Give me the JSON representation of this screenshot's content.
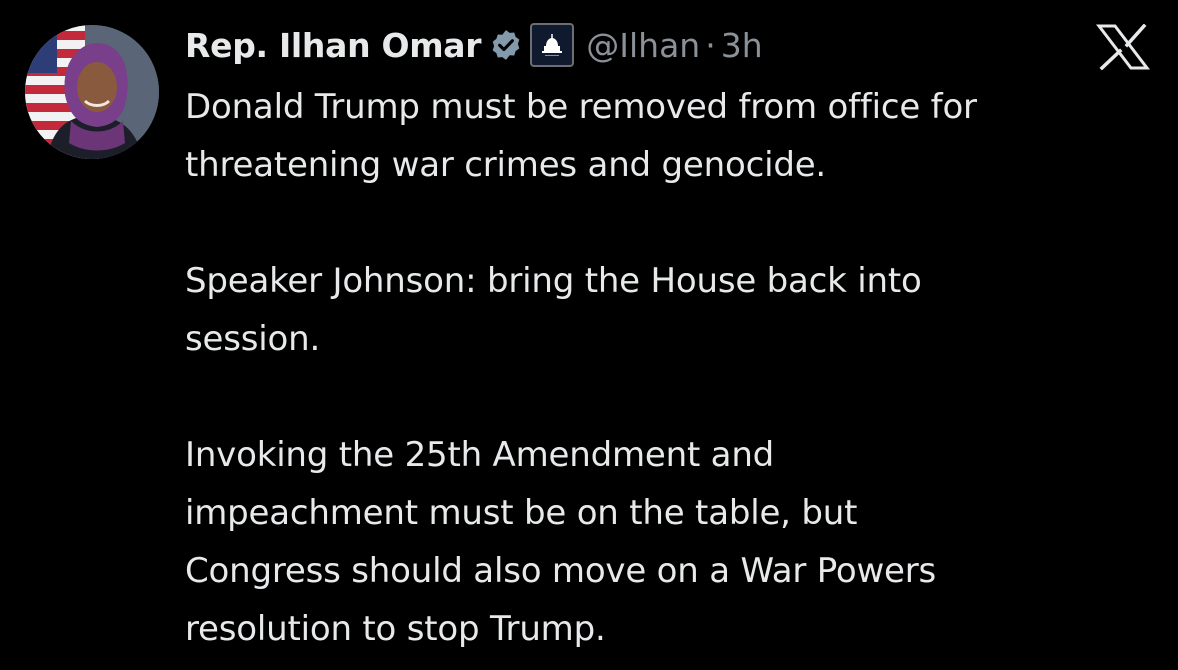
{
  "tweet": {
    "author": {
      "display_name": "Rep. Ilhan Omar",
      "handle": "@Ilhan",
      "verified_icon": "verified-badge-icon",
      "affiliation_icon": "us-capitol-badge-icon",
      "avatar_icon": "profile-avatar"
    },
    "separator": "·",
    "timestamp": "3h",
    "platform_icon": "x-logo-icon",
    "paragraphs": [
      "Donald Trump must be removed from office for\nthreatening war crimes and genocide.",
      "Speaker Johnson: bring the House back into\nsession.",
      "Invoking the 25th Amendment and\nimpeachment must be on the table, but\nCongress should also move on a War Powers\nresolution to stop Trump."
    ]
  },
  "colors": {
    "background": "#000000",
    "text_primary": "#e7e9ea",
    "text_secondary": "#8b9198",
    "verified_badge": "#829aab"
  }
}
